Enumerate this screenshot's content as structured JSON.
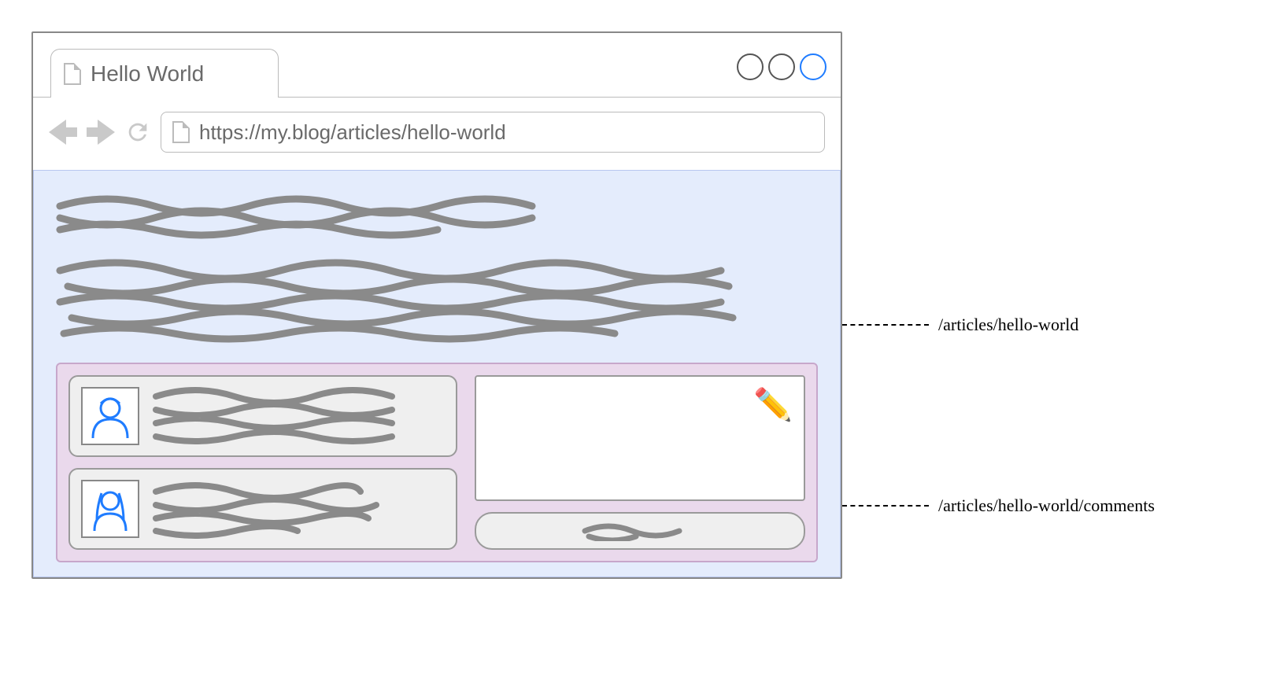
{
  "browser": {
    "tab_title": "Hello World",
    "url": "https://my.blog/articles/hello-world"
  },
  "icons": {
    "page": "page-icon",
    "back": "back-arrow",
    "forward": "forward-arrow",
    "reload": "reload-icon",
    "pencil": "✏️"
  },
  "window_controls": [
    "minimize",
    "maximize",
    "close"
  ],
  "article": {
    "content_placeholder": "scribble",
    "comments": [
      {
        "avatar": "male",
        "body_placeholder": "scribble"
      },
      {
        "avatar": "female",
        "body_placeholder": "scribble"
      }
    ],
    "compose_placeholder": "",
    "submit_label_placeholder": "scribble"
  },
  "annotations": {
    "article_route": "/articles/hello-world",
    "comments_route": "/articles/hello-world/comments"
  }
}
